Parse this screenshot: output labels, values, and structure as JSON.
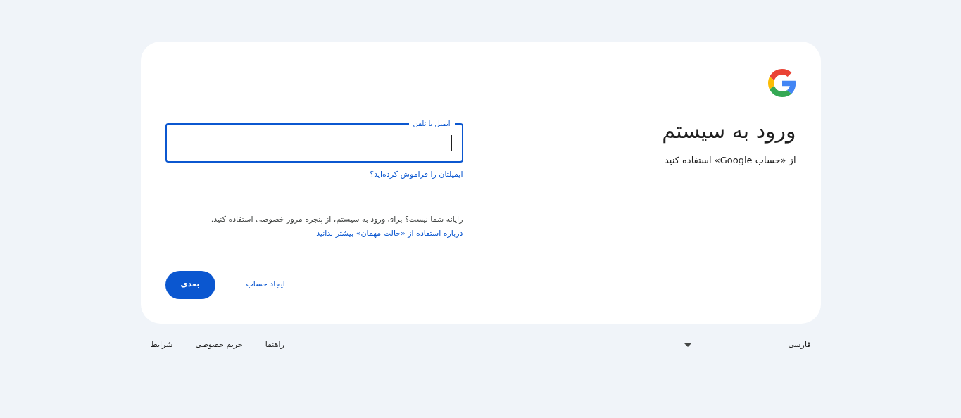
{
  "header": {
    "title": "ورود به سیستم",
    "subtitle": "از «حساب Google» استفاده کنید"
  },
  "email_field": {
    "label": "ایمیل یا تلفن",
    "focused": true
  },
  "forgot_link": "ایمیلتان را فراموش کرده‌اید؟",
  "guest_note": {
    "text": "رایانه شما نیست؟ برای ورود به سیستم، از پنجره مرور خصوصی استفاده کنید.",
    "link": "درباره استفاده از «حالت مهمان» بیشتر بدانید"
  },
  "create_account": "ایجاد حساب",
  "next_button": "بعدی",
  "footer": {
    "language": "فارسی",
    "links": [
      "راهنما",
      "حریم خصوصی",
      "شرایط"
    ]
  }
}
